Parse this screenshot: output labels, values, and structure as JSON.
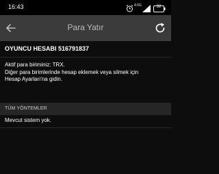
{
  "status_bar": {
    "time": "16:43",
    "network": "4.5G",
    "battery": "32",
    "icons": [
      "alarm-icon",
      "network-type-icon",
      "signal-icon",
      "battery-icon"
    ]
  },
  "app_bar": {
    "title": "Para Yatır",
    "back_icon": "back-arrow-icon",
    "refresh_icon": "refresh-icon"
  },
  "account": {
    "title": "OYUNCU HESABI 516791837",
    "active_currency": "Aktif para biriminiz: TRX.",
    "instruction_line1": "Diğer para birimlerinde hesap eklemek veya silmek için",
    "instruction_line2": "Hesap Ayarları'na gidin."
  },
  "methods": {
    "section_label": "TÜM YÖNTEMLER",
    "empty_message": "Mevcut sistem yok."
  },
  "colors": {
    "background": "#0d0d0d",
    "app_bar": "#3b3b3b",
    "section_band": "#262626",
    "text": "#ffffff",
    "muted_text": "#bdbdbd"
  }
}
